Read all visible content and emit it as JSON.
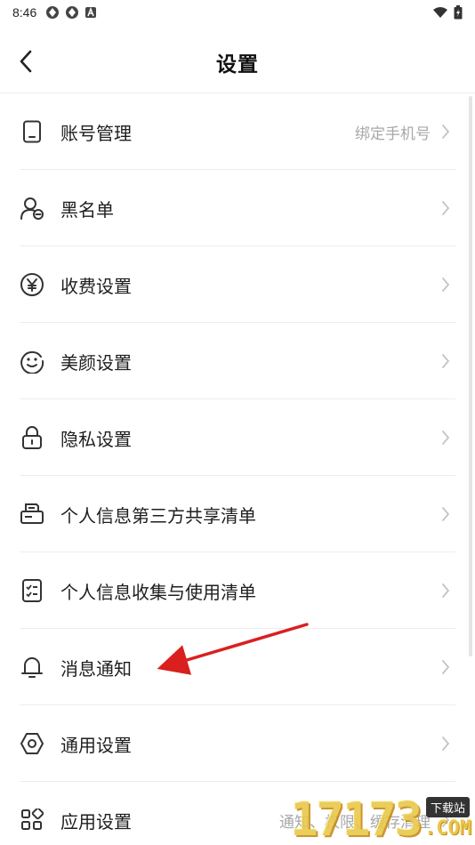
{
  "status_bar": {
    "time": "8:46",
    "icons": [
      "gear-notification-icon",
      "gear-notification-icon",
      "a-notification-icon"
    ],
    "right_icons": [
      "wifi-icon",
      "battery-icon"
    ]
  },
  "header": {
    "title": "设置"
  },
  "settings": {
    "items": [
      {
        "label": "账号管理",
        "hint": "绑定手机号",
        "icon": "phone-icon"
      },
      {
        "label": "黑名单",
        "hint": "",
        "icon": "blocked-user-icon"
      },
      {
        "label": "收费设置",
        "hint": "",
        "icon": "yen-icon"
      },
      {
        "label": "美颜设置",
        "hint": "",
        "icon": "face-icon"
      },
      {
        "label": "隐私设置",
        "hint": "",
        "icon": "lock-icon"
      },
      {
        "label": "个人信息第三方共享清单",
        "hint": "",
        "icon": "share-list-icon"
      },
      {
        "label": "个人信息收集与使用清单",
        "hint": "",
        "icon": "checklist-icon"
      },
      {
        "label": "消息通知",
        "hint": "",
        "icon": "bell-icon"
      },
      {
        "label": "通用设置",
        "hint": "",
        "icon": "hexagon-settings-icon"
      },
      {
        "label": "应用设置",
        "hint": "通知、权限、缓存清理",
        "icon": "apps-grid-icon"
      }
    ]
  },
  "watermark": {
    "number": "17173",
    "tag": "下载站",
    "suffix": ".COM"
  },
  "colors": {
    "annotation_arrow": "#d9201f",
    "divider": "#ededed",
    "hint_text": "#a8a8a8"
  }
}
